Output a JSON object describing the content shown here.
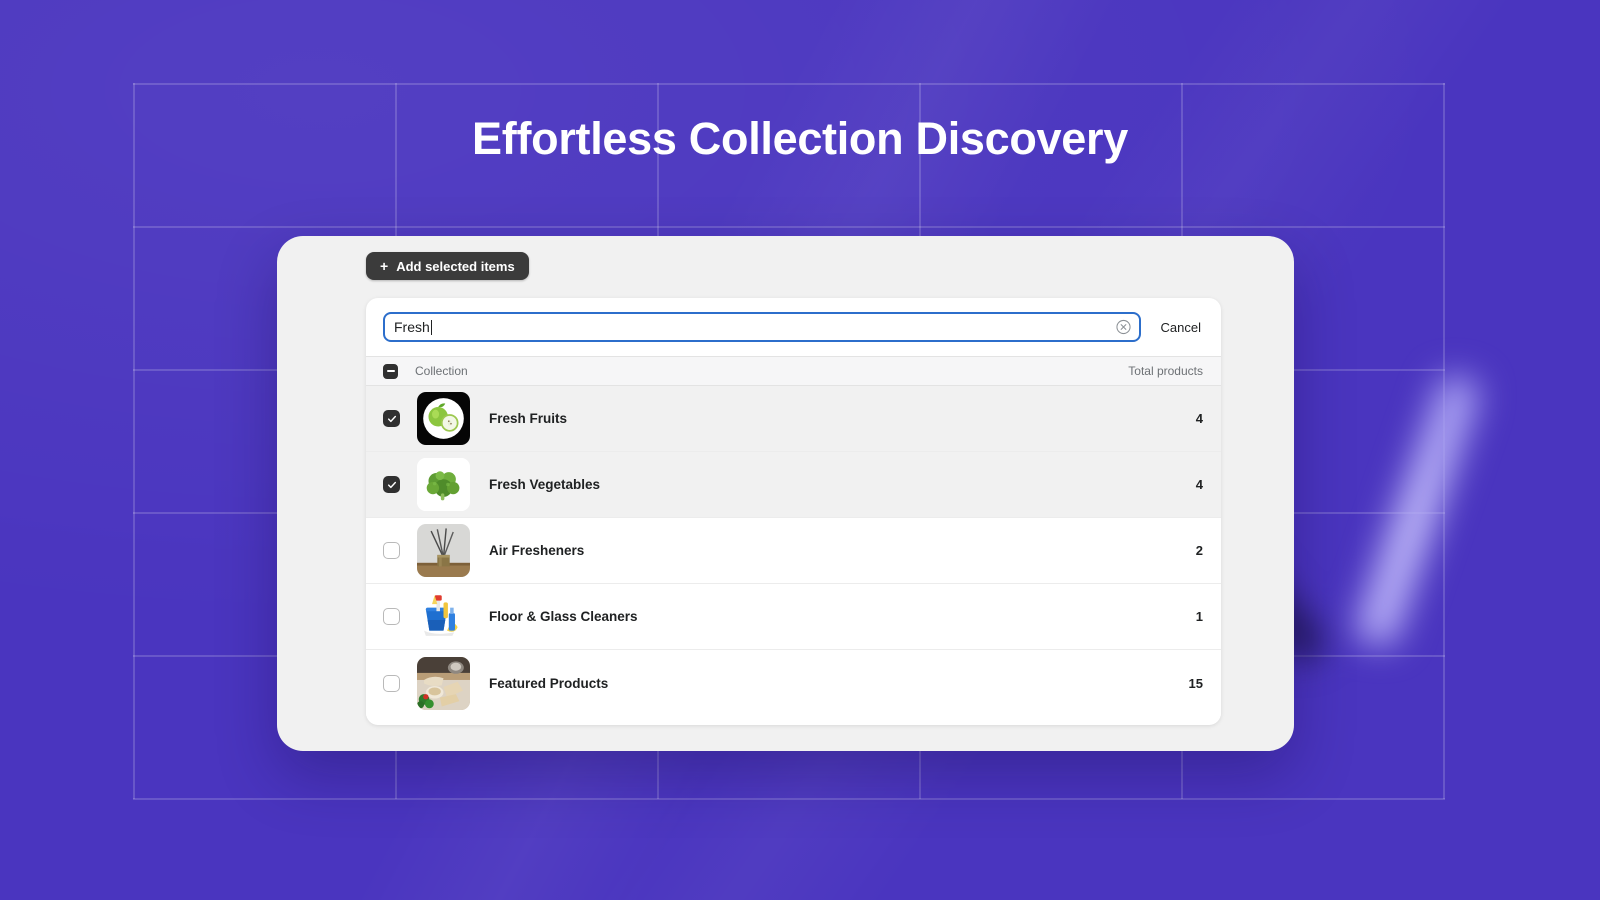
{
  "page": {
    "title": "Effortless Collection Discovery",
    "background_color": "#4a35bf",
    "card_color": "#f1f1f1",
    "panel_color": "#ffffff"
  },
  "toolbar": {
    "add_button_label": "Add selected items",
    "add_button_plus": "+"
  },
  "search": {
    "value": "Fresh",
    "placeholder": "Search collections",
    "clear_icon": "clear-circle-icon",
    "cancel_label": "Cancel",
    "focus_color": "#2c6ecb"
  },
  "table": {
    "header": {
      "select_all_state": "indeterminate",
      "collection_label": "Collection",
      "total_products_label": "Total products"
    },
    "rows": [
      {
        "name": "Fresh Fruits",
        "count": "4",
        "checked": true,
        "thumb": "green-apples-icon"
      },
      {
        "name": "Fresh Vegetables",
        "count": "4",
        "checked": true,
        "thumb": "broccoli-icon"
      },
      {
        "name": "Air Fresheners",
        "count": "2",
        "checked": false,
        "thumb": "reed-diffuser-icon"
      },
      {
        "name": "Floor & Glass Cleaners",
        "count": "1",
        "checked": false,
        "thumb": "cleaning-bucket-icon"
      },
      {
        "name": "Featured Products",
        "count": "15",
        "checked": false,
        "thumb": "food-table-photo-icon"
      }
    ]
  }
}
